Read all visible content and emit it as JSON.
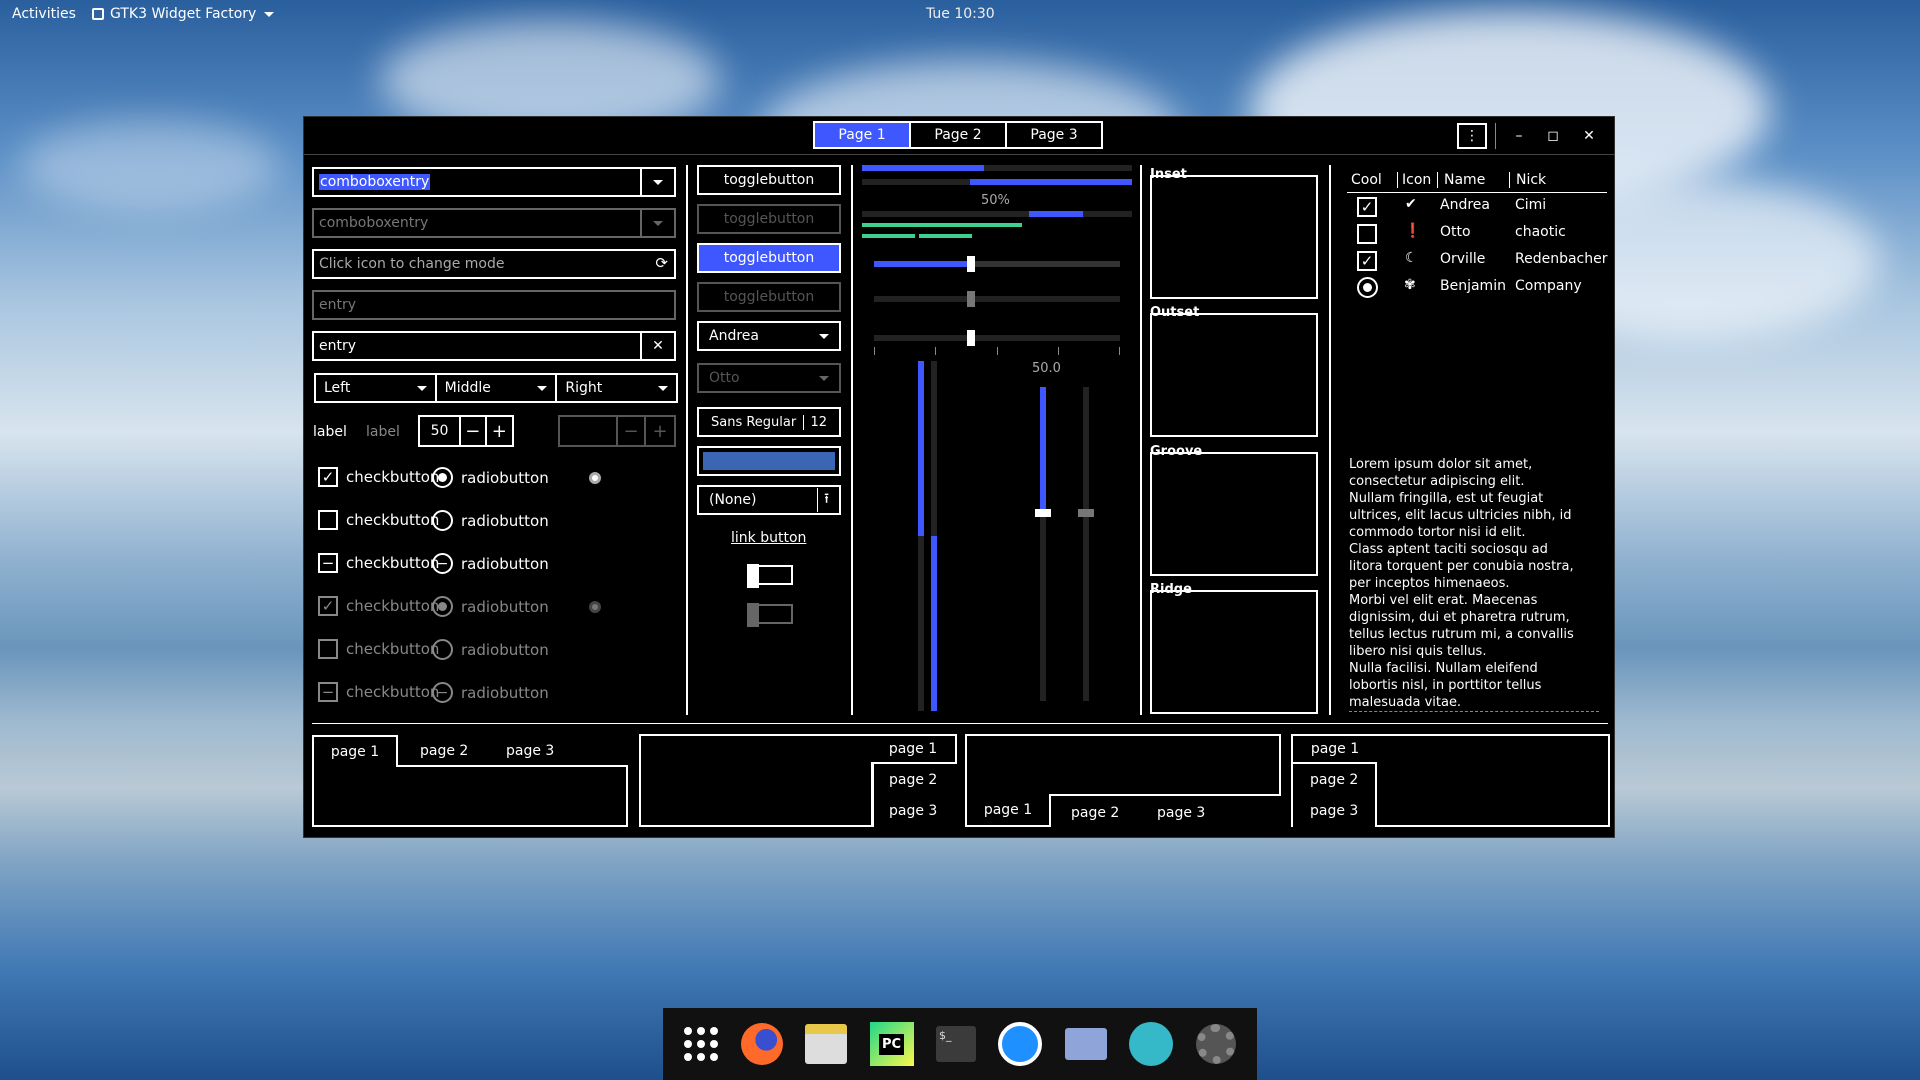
{
  "topbar": {
    "activities": "Activities",
    "app": "GTK3 Widget Factory",
    "clock": "Tue 10:30"
  },
  "header": {
    "pages": [
      "Page 1",
      "Page 2",
      "Page 3"
    ]
  },
  "entries": {
    "combo1": "comboboxentry",
    "combo2": "comboboxentry",
    "mode_placeholder": "Click icon to change mode",
    "entry_placeholder": "entry",
    "entry_value": "entry"
  },
  "combos3": [
    "Left",
    "Middle",
    "Right"
  ],
  "spin": {
    "label1": "label",
    "label2": "label",
    "value": "50"
  },
  "checks": {
    "label": "checkbutton",
    "radio": "radiobutton"
  },
  "col2": {
    "toggle": "togglebutton",
    "combo_andrea": "Andrea",
    "combo_otto": "Otto",
    "font": "Sans Regular",
    "font_size": "12",
    "file": "(None)",
    "link": "link button"
  },
  "sliders": {
    "progress_text": "50%",
    "scale_value": "50.0"
  },
  "frames": [
    "Inset",
    "Outset",
    "Groove",
    "Ridge"
  ],
  "tree": {
    "headers": [
      "Cool",
      "Icon",
      "Name",
      "Nick"
    ],
    "rows": [
      {
        "name": "Andrea",
        "nick": "Cimi"
      },
      {
        "name": "Otto",
        "nick": "chaotic"
      },
      {
        "name": "Orville",
        "nick": "Redenbacher"
      },
      {
        "name": "Benjamin",
        "nick": "Company"
      }
    ]
  },
  "lorem": [
    "Lorem ipsum dolor sit amet,",
    "consectetur adipiscing elit.",
    "Nullam fringilla, est ut feugiat",
    "ultrices, elit lacus ultricies nibh, id",
    "commodo tortor nisi id elit.",
    "Class aptent taciti sociosqu ad",
    "litora torquent per conubia nostra,",
    "per inceptos himenaeos.",
    "Morbi vel elit erat. Maecenas",
    "dignissim, dui et pharetra rutrum,",
    "tellus lectus rutrum mi, a convallis",
    "libero nisi quis tellus.",
    "Nulla facilisi. Nullam eleifend",
    "lobortis nisl, in porttitor tellus",
    "malesuada vitae."
  ],
  "notebook_tabs": [
    "page 1",
    "page 2",
    "page 3"
  ],
  "accent": "#3e57ff"
}
